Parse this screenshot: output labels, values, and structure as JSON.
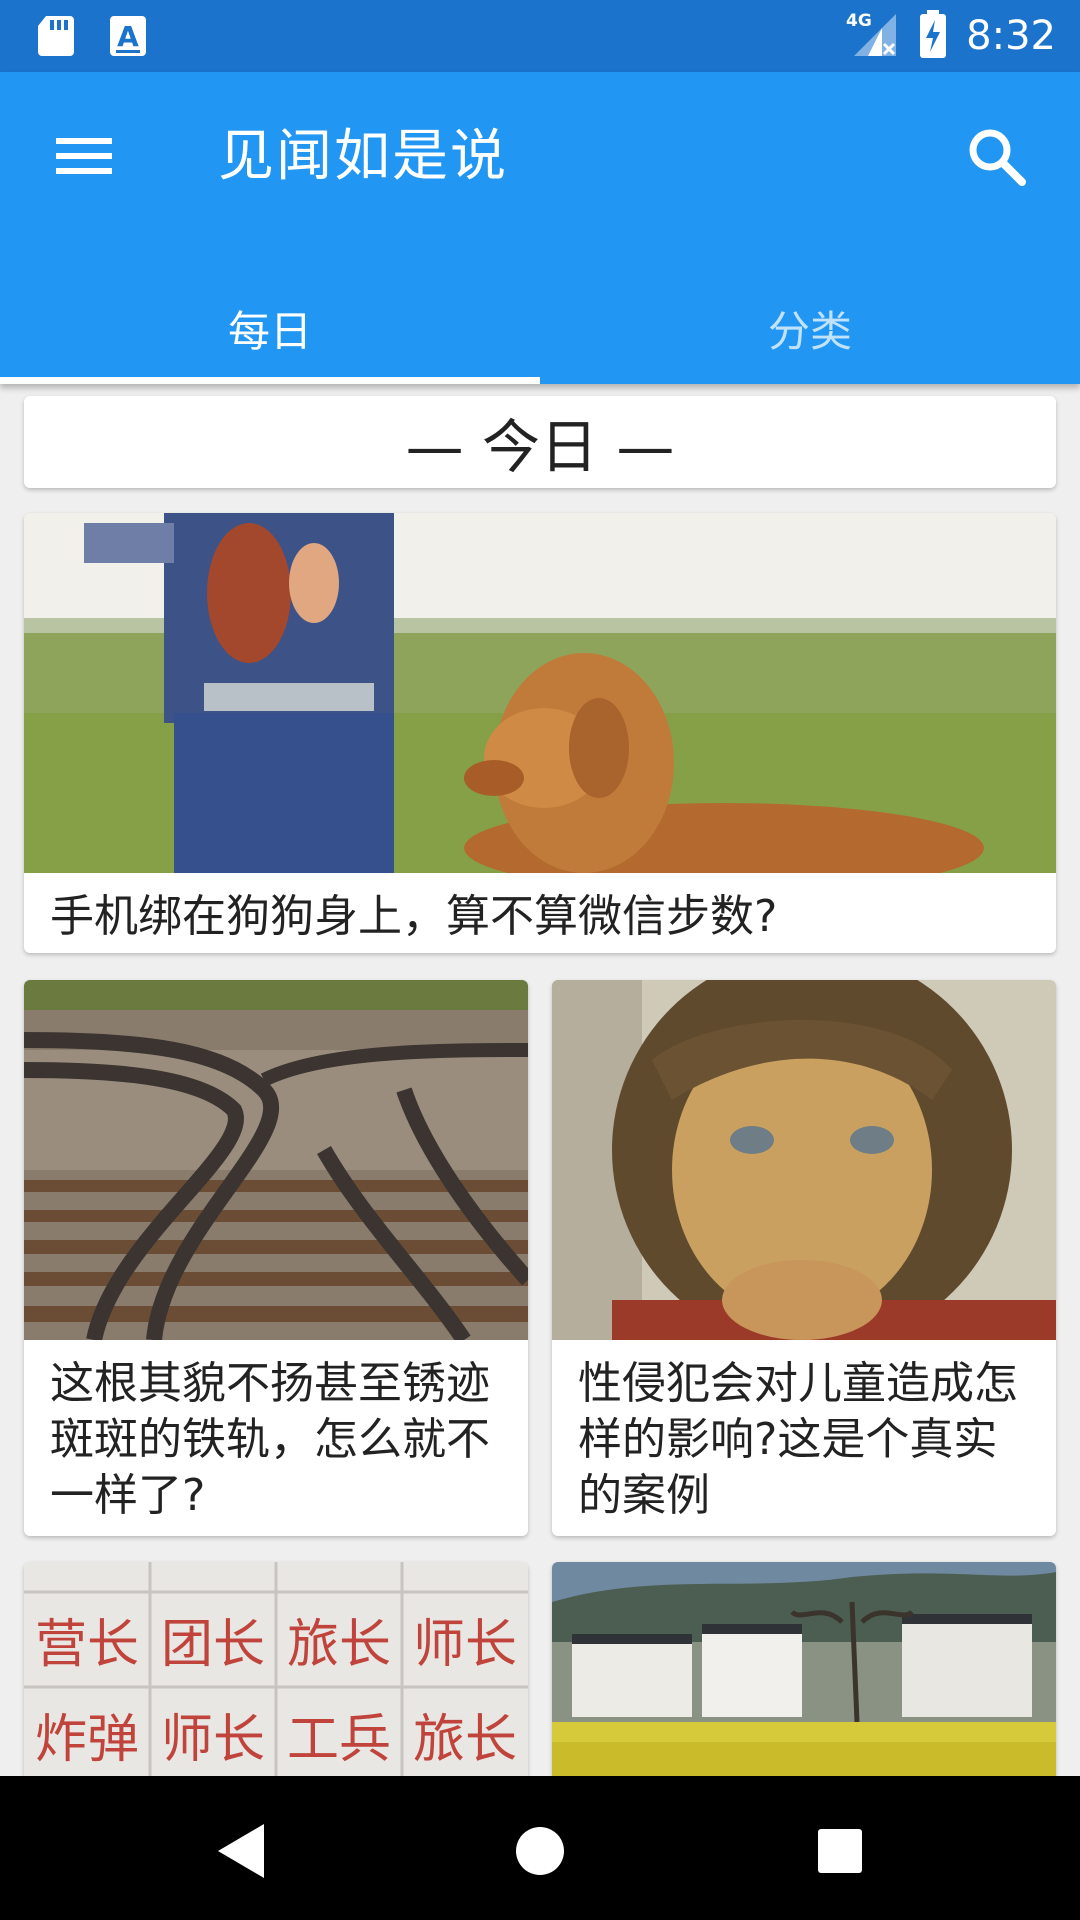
{
  "status_bar": {
    "time": "8:32",
    "network": "4G",
    "left_icons": [
      "sd-card-icon",
      "text-a-icon"
    ],
    "right_icons": [
      "signal-4g-icon",
      "battery-charging-icon"
    ]
  },
  "app_bar": {
    "title": "见闻如是说",
    "menu_icon": "hamburger-menu-icon",
    "search_icon": "search-icon",
    "color": "#2196f3"
  },
  "tabs": [
    {
      "label": "每日",
      "active": true
    },
    {
      "label": "分类",
      "active": false
    }
  ],
  "section_header": "— 今日 —",
  "cards": [
    {
      "title": "手机绑在狗狗身上，算不算微信步数?",
      "image": "man-and-golden-retriever-on-grass"
    },
    {
      "title": "这根其貌不扬甚至锈迹斑斑的铁轨，怎么就不一样了?",
      "image": "curved-railway-tracks"
    },
    {
      "title": "性侵犯会对儿童造成怎样的影响?这是个真实的案例",
      "image": "girl-portrait"
    },
    {
      "title": "",
      "image": "red-chinese-characters-tiles"
    },
    {
      "title": "",
      "image": "village-with-rapeseed-field"
    }
  ],
  "image_text": {
    "tiles_row1": [
      "营长",
      "团长",
      "旅长",
      "师长"
    ],
    "tiles_row2": [
      "炸弹",
      "师长",
      "工兵",
      "旅长"
    ]
  },
  "nav_bar": {
    "back_icon": "back-triangle-icon",
    "home_icon": "home-circle-icon",
    "recents_icon": "recents-square-icon"
  }
}
